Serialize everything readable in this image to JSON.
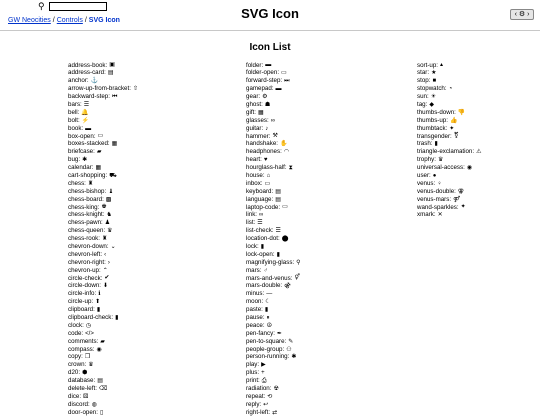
{
  "header": {
    "search": {
      "value": "",
      "placeholder": ""
    },
    "breadcrumb": {
      "items": [
        "GW Neocities",
        "Controls"
      ],
      "separator": "/",
      "current": "SVG Icon"
    },
    "title": "SVG Icon",
    "settings_label": "‹ ⚙ ›"
  },
  "main": {
    "section_title": "Icon List",
    "columns": [
      [
        {
          "name": "address-book",
          "glyph": "▣"
        },
        {
          "name": "address-card",
          "glyph": "▤"
        },
        {
          "name": "anchor",
          "glyph": "⚓"
        },
        {
          "name": "arrow-up-from-bracket",
          "glyph": "⇧"
        },
        {
          "name": "backward-step",
          "glyph": "⏮"
        },
        {
          "name": "bars",
          "glyph": "☰"
        },
        {
          "name": "bell",
          "glyph": "🔔"
        },
        {
          "name": "bolt",
          "glyph": "⚡"
        },
        {
          "name": "book",
          "glyph": "▬"
        },
        {
          "name": "box-open",
          "glyph": "▭"
        },
        {
          "name": "boxes-stacked",
          "glyph": "▦"
        },
        {
          "name": "briefcase",
          "glyph": "▰"
        },
        {
          "name": "bug",
          "glyph": "✱"
        },
        {
          "name": "calendar",
          "glyph": "▦"
        },
        {
          "name": "cart-shopping",
          "glyph": "⛟"
        },
        {
          "name": "chess",
          "glyph": "♜"
        },
        {
          "name": "chess-bishop",
          "glyph": "♝"
        },
        {
          "name": "chess-board",
          "glyph": "▩"
        },
        {
          "name": "chess-king",
          "glyph": "♚"
        },
        {
          "name": "chess-knight",
          "glyph": "♞"
        },
        {
          "name": "chess-pawn",
          "glyph": "♟"
        },
        {
          "name": "chess-queen",
          "glyph": "♛"
        },
        {
          "name": "chess-rook",
          "glyph": "♜"
        },
        {
          "name": "chevron-down",
          "glyph": "⌄"
        },
        {
          "name": "chevron-left",
          "glyph": "‹"
        },
        {
          "name": "chevron-right",
          "glyph": "›"
        },
        {
          "name": "chevron-up",
          "glyph": "⌃"
        },
        {
          "name": "circle-check",
          "glyph": "✔"
        },
        {
          "name": "circle-down",
          "glyph": "⬇"
        },
        {
          "name": "circle-info",
          "glyph": "ℹ"
        },
        {
          "name": "circle-up",
          "glyph": "⬆"
        },
        {
          "name": "clipboard",
          "glyph": "▮"
        },
        {
          "name": "clipboard-check",
          "glyph": "▮"
        },
        {
          "name": "clock",
          "glyph": "◷"
        },
        {
          "name": "code",
          "glyph": "</>"
        },
        {
          "name": "comments",
          "glyph": "▰"
        },
        {
          "name": "compass",
          "glyph": "◉"
        },
        {
          "name": "copy",
          "glyph": "❐"
        },
        {
          "name": "crown",
          "glyph": "♛"
        },
        {
          "name": "d20",
          "glyph": "⬢"
        },
        {
          "name": "database",
          "glyph": "▤"
        },
        {
          "name": "delete-left",
          "glyph": "⌫"
        },
        {
          "name": "dice",
          "glyph": "⚄"
        },
        {
          "name": "discord",
          "glyph": "◍"
        },
        {
          "name": "door-open",
          "glyph": "▯"
        }
      ],
      [
        {
          "name": "folder",
          "glyph": "▬"
        },
        {
          "name": "folder-open",
          "glyph": "▭"
        },
        {
          "name": "forward-step",
          "glyph": "⏭"
        },
        {
          "name": "gamepad",
          "glyph": "▬"
        },
        {
          "name": "gear",
          "glyph": "⚙"
        },
        {
          "name": "ghost",
          "glyph": "☗"
        },
        {
          "name": "gift",
          "glyph": "▦"
        },
        {
          "name": "glasses",
          "glyph": "∞"
        },
        {
          "name": "guitar",
          "glyph": "♪"
        },
        {
          "name": "hammer",
          "glyph": "⚒"
        },
        {
          "name": "handshake",
          "glyph": "✋"
        },
        {
          "name": "headphones",
          "glyph": "◠"
        },
        {
          "name": "heart",
          "glyph": "♥"
        },
        {
          "name": "hourglass-half",
          "glyph": "⧗"
        },
        {
          "name": "house",
          "glyph": "⌂"
        },
        {
          "name": "inbox",
          "glyph": "▭"
        },
        {
          "name": "keyboard",
          "glyph": "▤"
        },
        {
          "name": "language",
          "glyph": "▤"
        },
        {
          "name": "laptop-code",
          "glyph": "▭"
        },
        {
          "name": "link",
          "glyph": "∞"
        },
        {
          "name": "list",
          "glyph": "☰"
        },
        {
          "name": "list-check",
          "glyph": "☰"
        },
        {
          "name": "location-dot",
          "glyph": "⬤"
        },
        {
          "name": "lock",
          "glyph": "▮"
        },
        {
          "name": "lock-open",
          "glyph": "▮"
        },
        {
          "name": "magnifying-glass",
          "glyph": "⚲"
        },
        {
          "name": "mars",
          "glyph": "♂"
        },
        {
          "name": "mars-and-venus",
          "glyph": "⚥"
        },
        {
          "name": "mars-double",
          "glyph": "⚣"
        },
        {
          "name": "minus",
          "glyph": "—"
        },
        {
          "name": "moon",
          "glyph": "☾"
        },
        {
          "name": "paste",
          "glyph": "▮"
        },
        {
          "name": "pause",
          "glyph": "⏸"
        },
        {
          "name": "peace",
          "glyph": "☮"
        },
        {
          "name": "pen-fancy",
          "glyph": "✒"
        },
        {
          "name": "pen-to-square",
          "glyph": "✎"
        },
        {
          "name": "people-group",
          "glyph": "⚇"
        },
        {
          "name": "person-running",
          "glyph": "✱"
        },
        {
          "name": "play",
          "glyph": "▶"
        },
        {
          "name": "plus",
          "glyph": "+"
        },
        {
          "name": "print",
          "glyph": "⎙"
        },
        {
          "name": "radiation",
          "glyph": "☢"
        },
        {
          "name": "repeat",
          "glyph": "⟲"
        },
        {
          "name": "reply",
          "glyph": "↩"
        },
        {
          "name": "right-left",
          "glyph": "⇄"
        }
      ],
      [
        {
          "name": "sort-up",
          "glyph": "▴"
        },
        {
          "name": "star",
          "glyph": "★"
        },
        {
          "name": "stop",
          "glyph": "■"
        },
        {
          "name": "stopwatch",
          "glyph": "◔"
        },
        {
          "name": "sun",
          "glyph": "☀"
        },
        {
          "name": "tag",
          "glyph": "◆"
        },
        {
          "name": "thumbs-down",
          "glyph": "👎"
        },
        {
          "name": "thumbs-up",
          "glyph": "👍"
        },
        {
          "name": "thumbtack",
          "glyph": "✦"
        },
        {
          "name": "transgender",
          "glyph": "⚧"
        },
        {
          "name": "trash",
          "glyph": "▮"
        },
        {
          "name": "triangle-exclamation",
          "glyph": "⚠"
        },
        {
          "name": "trophy",
          "glyph": "♛"
        },
        {
          "name": "universal-access",
          "glyph": "◉"
        },
        {
          "name": "user",
          "glyph": "●"
        },
        {
          "name": "venus",
          "glyph": "♀"
        },
        {
          "name": "venus-double",
          "glyph": "⚢"
        },
        {
          "name": "venus-mars",
          "glyph": "⚤"
        },
        {
          "name": "wand-sparkles",
          "glyph": "✦"
        },
        {
          "name": "xmark",
          "glyph": "✕"
        }
      ]
    ]
  }
}
